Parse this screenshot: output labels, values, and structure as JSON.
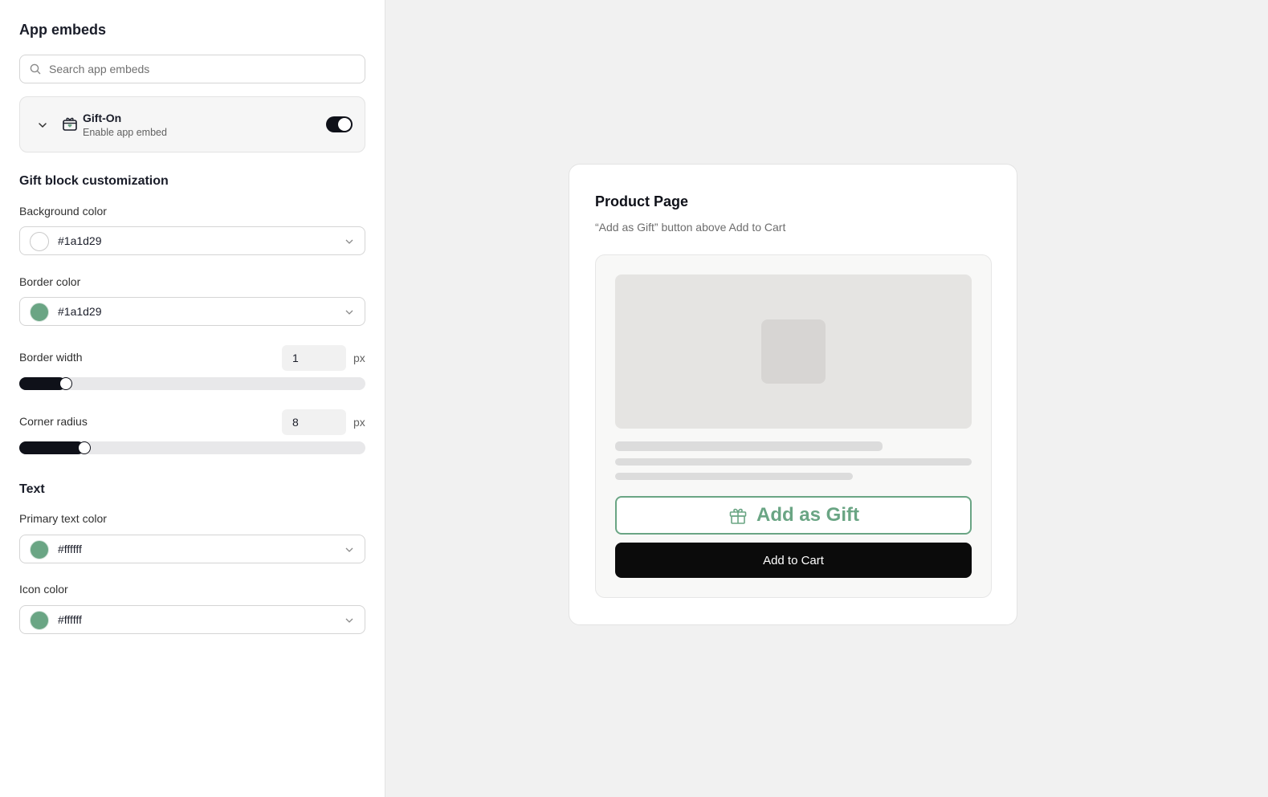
{
  "sidebar": {
    "title": "App embeds",
    "search": {
      "placeholder": "Search app embeds",
      "value": ""
    },
    "embed": {
      "name": "Gift-On",
      "subtitle": "Enable app embed",
      "enabled": true,
      "icon": "gift-icon"
    },
    "gift_block": {
      "title": "Gift block customization",
      "background_color": {
        "label": "Background color",
        "value": "#1a1d29",
        "swatch": "#ffffff"
      },
      "border_color": {
        "label": "Border color",
        "value": "#1a1d29",
        "swatch": "#6aa584"
      },
      "border_width": {
        "label": "Border width",
        "value": "1",
        "unit": "px",
        "level_percent": 11.5
      },
      "corner_radius": {
        "label": "Corner radius",
        "value": "8",
        "unit": "px",
        "level_percent": 17
      }
    },
    "text_section": {
      "title": "Text",
      "primary_text_color": {
        "label": "Primary text color",
        "value": "#ffffff",
        "swatch": "#6aa584"
      },
      "icon_color": {
        "label": "Icon color",
        "value": "#ffffff",
        "swatch": "#6aa584"
      }
    }
  },
  "preview": {
    "title": "Product Page",
    "subtitle": "“Add as Gift” button above Add to Cart",
    "gift_button": {
      "label": "Add as Gift",
      "color": "#6aa584",
      "icon": "gift-icon"
    },
    "cart_button": {
      "label": "Add to Cart",
      "color": "#0b0b0b"
    }
  }
}
